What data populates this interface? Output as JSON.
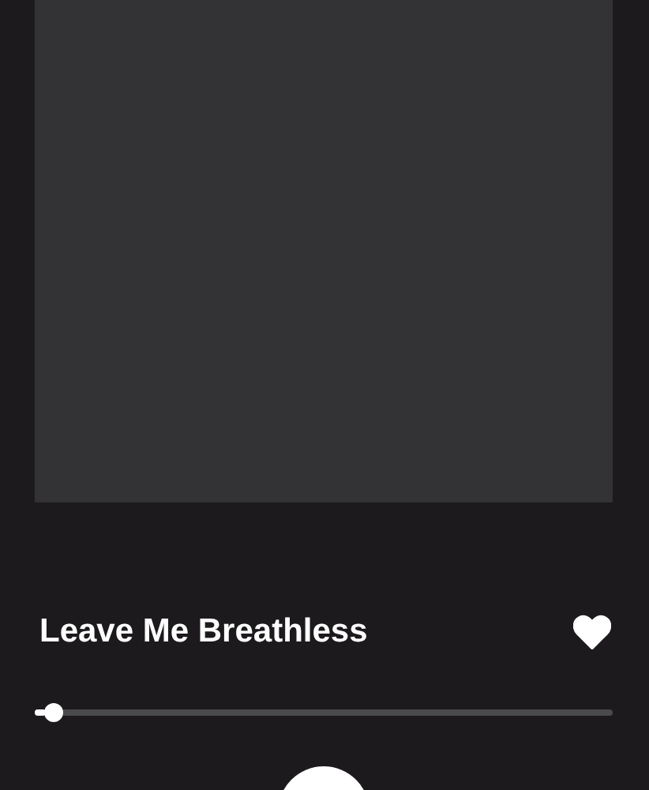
{
  "track": {
    "title": "Leave Me Breathless",
    "liked": true
  },
  "progress": {
    "level": 0.02
  }
}
